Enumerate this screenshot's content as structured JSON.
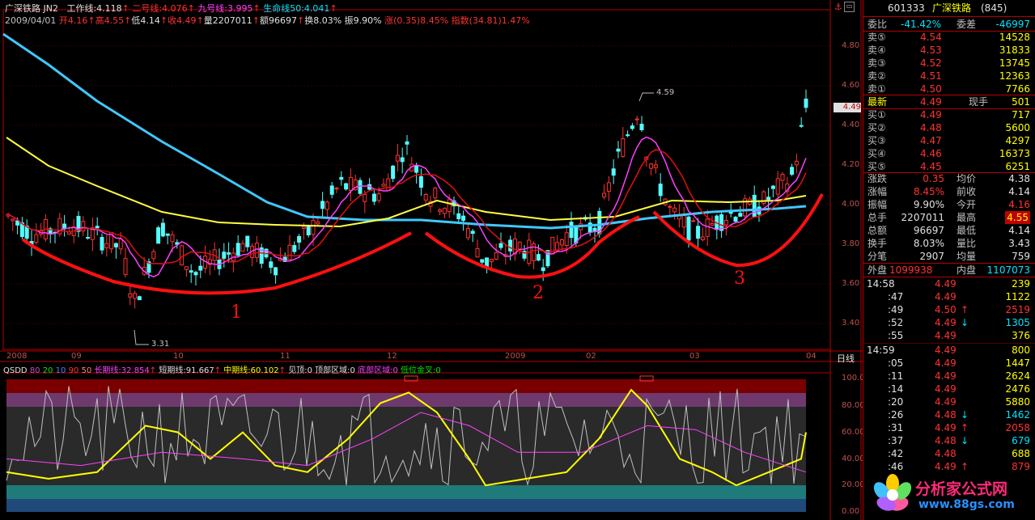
{
  "stock": {
    "name": "广深铁路",
    "title_line": "广深铁路 JN2",
    "code": "601333",
    "code_name": "广深铁路",
    "code_num": "(845)"
  },
  "indicators": {
    "work_line": "工作线:4.118",
    "line2": "二号线:4.076",
    "line9": "九号线:3.995",
    "life_line": "生命线50:4.041"
  },
  "bar_info": {
    "date": "2009/04/01",
    "open": "开4.16",
    "high": "高4.55",
    "low": "低4.14",
    "close": "收4.49",
    "vol": "量2207011",
    "amount": "额96697",
    "turnover": "换8.03%",
    "amplitude": "振9.90%",
    "change": "涨(0.35)8.45%",
    "index": "指数(34.81)1.47%"
  },
  "price_axis": [
    "4.80",
    "4.60",
    "4.40",
    "4.20",
    "4.00",
    "3.80",
    "3.60",
    "3.40"
  ],
  "current_price_tag": "4.49",
  "annotations": {
    "high_label": "4.59",
    "low_label": "3.31",
    "cup1": "1",
    "cup2": "2",
    "cup3": "3"
  },
  "x_axis": [
    "2008",
    "09",
    "10",
    "11",
    "12",
    "2009",
    "02",
    "03",
    "04"
  ],
  "period_label": "日线",
  "qsdd": {
    "title": "QSDD",
    "p1": "80",
    "p2": "20",
    "p3": "10",
    "p4": "90",
    "p5": "50",
    "long": "长期线:32.854",
    "short": "短期线:91.667",
    "mid": "中期线:60.102",
    "jian": "见顶:0",
    "top_zone": "顶部区域:0",
    "bottom_zone": "底部区域:0",
    "golden": "低位金叉:0",
    "axis": [
      "100.00",
      "80.00",
      "60.00",
      "40.00",
      "20.00",
      "0.00"
    ]
  },
  "panel": {
    "weibi_label": "委比",
    "weibi_val": "-41.42%",
    "weicha_label": "委差",
    "weicha_val": "-46997",
    "asks": [
      {
        "label": "卖⑤",
        "price": "4.54",
        "vol": "14528"
      },
      {
        "label": "卖④",
        "price": "4.53",
        "vol": "31833"
      },
      {
        "label": "卖③",
        "price": "4.52",
        "vol": "13745"
      },
      {
        "label": "卖②",
        "price": "4.51",
        "vol": "12363"
      },
      {
        "label": "卖①",
        "price": "4.50",
        "vol": "7766"
      }
    ],
    "last_label": "最新",
    "last_price": "4.49",
    "hand_label": "现手",
    "hand_val": "501",
    "bids": [
      {
        "label": "买①",
        "price": "4.49",
        "vol": "717"
      },
      {
        "label": "买②",
        "price": "4.48",
        "vol": "5600"
      },
      {
        "label": "买③",
        "price": "4.47",
        "vol": "4297"
      },
      {
        "label": "买④",
        "price": "4.46",
        "vol": "16373"
      },
      {
        "label": "买⑤",
        "price": "4.45",
        "vol": "6251"
      }
    ],
    "stats": [
      {
        "l1": "涨跌",
        "v1": "0.35",
        "l2": "均价",
        "v2": "4.38",
        "c1": "red",
        "c2": "white"
      },
      {
        "l1": "涨幅",
        "v1": "8.45%",
        "l2": "前收",
        "v2": "4.14",
        "c1": "red",
        "c2": "white"
      },
      {
        "l1": "振幅",
        "v1": "9.90%",
        "l2": "今开",
        "v2": "4.16",
        "c1": "white",
        "c2": "red"
      },
      {
        "l1": "总手",
        "v1": "2207011",
        "l2": "最高",
        "v2": "4.55",
        "c1": "white",
        "c2": "red"
      },
      {
        "l1": "总额",
        "v1": "96697",
        "l2": "最低",
        "v2": "4.14",
        "c1": "white",
        "c2": "white"
      },
      {
        "l1": "换手",
        "v1": "8.03%",
        "l2": "量比",
        "v2": "3.43",
        "c1": "white",
        "c2": "white"
      },
      {
        "l1": "分笔",
        "v1": "2907",
        "l2": "均量",
        "v2": "759",
        "c1": "white",
        "c2": "white"
      }
    ],
    "outer_label": "外盘",
    "outer_val": "1099938",
    "inner_label": "内盘",
    "inner_val": "1107073"
  },
  "ticks": [
    {
      "t": "14:58",
      "p": "4.49",
      "a": "",
      "v": "239",
      "vc": "yellow"
    },
    {
      "t": ":47",
      "p": "4.49",
      "a": "",
      "v": "1122",
      "vc": "yellow"
    },
    {
      "t": ":49",
      "p": "4.50",
      "a": "↑",
      "v": "2519",
      "vc": "red"
    },
    {
      "t": ":52",
      "p": "4.49",
      "a": "↓",
      "v": "1305",
      "vc": "cyan"
    },
    {
      "t": ":55",
      "p": "4.49",
      "a": "",
      "v": "376",
      "vc": "yellow"
    },
    {
      "t": "14:59",
      "p": "4.49",
      "a": "",
      "v": "800",
      "vc": "yellow"
    },
    {
      "t": ":05",
      "p": "4.49",
      "a": "",
      "v": "1447",
      "vc": "yellow"
    },
    {
      "t": ":11",
      "p": "4.49",
      "a": "",
      "v": "2624",
      "vc": "yellow"
    },
    {
      "t": ":14",
      "p": "4.49",
      "a": "",
      "v": "2476",
      "vc": "yellow"
    },
    {
      "t": ":20",
      "p": "4.49",
      "a": "",
      "v": "5880",
      "vc": "yellow"
    },
    {
      "t": ":26",
      "p": "4.48",
      "a": "↓",
      "v": "1462",
      "vc": "cyan"
    },
    {
      "t": ":31",
      "p": "4.49",
      "a": "↑",
      "v": "2058",
      "vc": "red"
    },
    {
      "t": ":37",
      "p": "4.48",
      "a": "↓",
      "v": "679",
      "vc": "cyan"
    },
    {
      "t": ":42",
      "p": "4.48",
      "a": "",
      "v": "688",
      "vc": "yellow"
    },
    {
      "t": ":46",
      "p": "4.49",
      "a": "↑",
      "v": "879",
      "vc": "red"
    }
  ],
  "watermark": {
    "text": "分析家公式网",
    "url": "www.88gs.com"
  }
}
